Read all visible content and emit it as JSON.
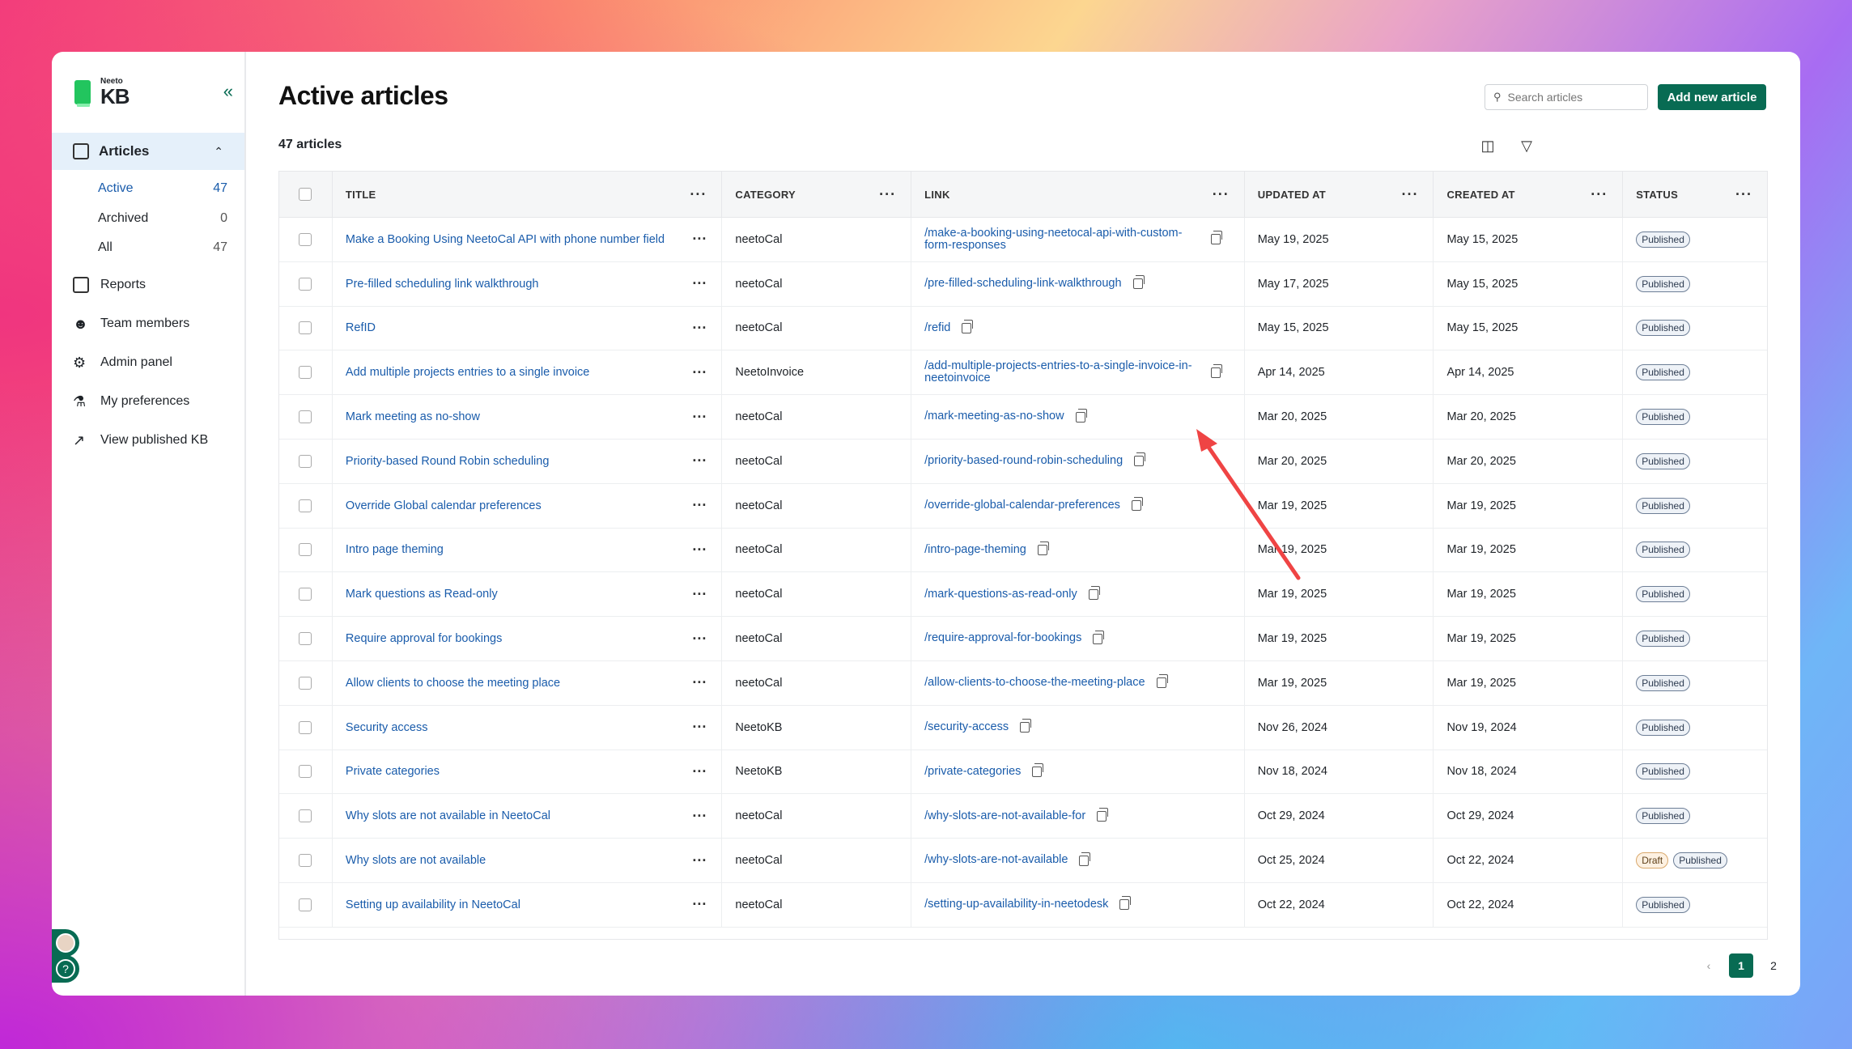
{
  "app": {
    "logo_small": "Neeto",
    "logo_big": "KB"
  },
  "sidebar": {
    "articles_label": "Articles",
    "sub": [
      {
        "label": "Active",
        "count": "47"
      },
      {
        "label": "Archived",
        "count": "0"
      },
      {
        "label": "All",
        "count": "47"
      }
    ],
    "items": [
      "Reports",
      "Team members",
      "Admin panel",
      "My preferences",
      "View published KB"
    ]
  },
  "header": {
    "title": "Active articles",
    "search_placeholder": "Search articles",
    "add_label": "Add new article",
    "count_label": "47 articles"
  },
  "table": {
    "columns": [
      "TITLE",
      "CATEGORY",
      "LINK",
      "UPDATED AT",
      "CREATED AT",
      "STATUS"
    ],
    "rows": [
      {
        "title": "Make a Booking Using NeetoCal API with phone number field",
        "category": "neetoCal",
        "link": "/make-a-booking-using-neetocal-api-with-custom-form-responses",
        "updated": "May 19, 2025",
        "created": "May 15, 2025",
        "status": [
          "Published"
        ]
      },
      {
        "title": "Pre-filled scheduling link walkthrough",
        "category": "neetoCal",
        "link": "/pre-filled-scheduling-link-walkthrough",
        "updated": "May 17, 2025",
        "created": "May 15, 2025",
        "status": [
          "Published"
        ]
      },
      {
        "title": "RefID",
        "category": "neetoCal",
        "link": "/refid",
        "updated": "May 15, 2025",
        "created": "May 15, 2025",
        "status": [
          "Published"
        ]
      },
      {
        "title": "Add multiple projects entries to a single invoice",
        "category": "NeetoInvoice",
        "link": "/add-multiple-projects-entries-to-a-single-invoice-in-neetoinvoice",
        "updated": "Apr 14, 2025",
        "created": "Apr 14, 2025",
        "status": [
          "Published"
        ]
      },
      {
        "title": "Mark meeting as no-show",
        "category": "neetoCal",
        "link": "/mark-meeting-as-no-show",
        "updated": "Mar 20, 2025",
        "created": "Mar 20, 2025",
        "status": [
          "Published"
        ]
      },
      {
        "title": "Priority-based Round Robin scheduling",
        "category": "neetoCal",
        "link": "/priority-based-round-robin-scheduling",
        "updated": "Mar 20, 2025",
        "created": "Mar 20, 2025",
        "status": [
          "Published"
        ]
      },
      {
        "title": "Override Global calendar preferences",
        "category": "neetoCal",
        "link": "/override-global-calendar-preferences",
        "updated": "Mar 19, 2025",
        "created": "Mar 19, 2025",
        "status": [
          "Published"
        ]
      },
      {
        "title": "Intro page theming",
        "category": "neetoCal",
        "link": "/intro-page-theming",
        "updated": "Mar 19, 2025",
        "created": "Mar 19, 2025",
        "status": [
          "Published"
        ]
      },
      {
        "title": "Mark questions as Read-only",
        "category": "neetoCal",
        "link": "/mark-questions-as-read-only",
        "updated": "Mar 19, 2025",
        "created": "Mar 19, 2025",
        "status": [
          "Published"
        ]
      },
      {
        "title": "Require approval for bookings",
        "category": "neetoCal",
        "link": "/require-approval-for-bookings",
        "updated": "Mar 19, 2025",
        "created": "Mar 19, 2025",
        "status": [
          "Published"
        ]
      },
      {
        "title": "Allow clients to choose the meeting place",
        "category": "neetoCal",
        "link": "/allow-clients-to-choose-the-meeting-place",
        "updated": "Mar 19, 2025",
        "created": "Mar 19, 2025",
        "status": [
          "Published"
        ]
      },
      {
        "title": "Security access",
        "category": "NeetoKB",
        "link": "/security-access",
        "updated": "Nov 26, 2024",
        "created": "Nov 19, 2024",
        "status": [
          "Published"
        ]
      },
      {
        "title": "Private categories",
        "category": "NeetoKB",
        "link": "/private-categories",
        "updated": "Nov 18, 2024",
        "created": "Nov 18, 2024",
        "status": [
          "Published"
        ]
      },
      {
        "title": "Why slots are not available in NeetoCal",
        "category": "neetoCal",
        "link": "/why-slots-are-not-available-for",
        "updated": "Oct 29, 2024",
        "created": "Oct 29, 2024",
        "status": [
          "Published"
        ]
      },
      {
        "title": "Why slots are not available",
        "category": "neetoCal",
        "link": "/why-slots-are-not-available",
        "updated": "Oct 25, 2024",
        "created": "Oct 22, 2024",
        "status": [
          "Draft",
          "Published"
        ]
      },
      {
        "title": "Setting up availability in NeetoCal",
        "category": "neetoCal",
        "link": "/setting-up-availability-in-neetodesk",
        "updated": "Oct 22, 2024",
        "created": "Oct 22, 2024",
        "status": [
          "Published"
        ]
      }
    ]
  },
  "pagination": {
    "pages": [
      "1",
      "2"
    ],
    "current": "1"
  },
  "colors": {
    "brand": "#086b53",
    "link": "#1a5cab",
    "annotation_arrow": "#ef4444"
  }
}
